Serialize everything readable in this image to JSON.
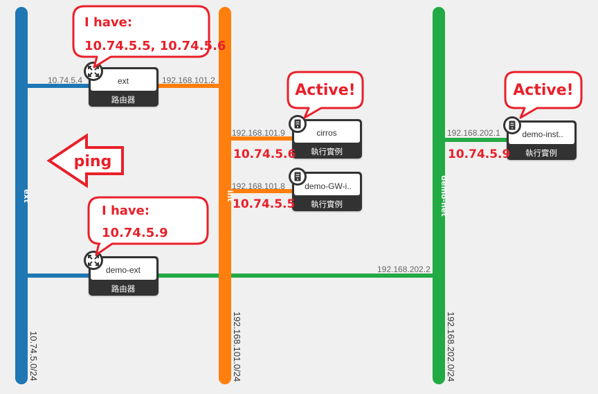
{
  "networks": [
    {
      "id": "ext",
      "label": "ext",
      "cidr": "10.74.5.0/24",
      "color": "#1f77b4"
    },
    {
      "id": "int",
      "label": "int",
      "cidr": "192.168.101.0/24",
      "color": "#ff7f0e"
    },
    {
      "id": "demo-net",
      "label": "demo-net",
      "cidr": "192.168.202.0/24",
      "color": "#22aa44"
    }
  ],
  "routers": [
    {
      "id": "router-ext",
      "name": "ext",
      "type_label": "路由器",
      "icon": "router-icon",
      "ports": [
        {
          "ip": "10.74.5.4"
        },
        {
          "ip": "192.168.101.2"
        }
      ]
    },
    {
      "id": "router-demo-ext",
      "name": "demo-ext",
      "type_label": "路由器",
      "icon": "router-icon",
      "ports": [
        {
          "ip": "192.168.202.2"
        }
      ]
    }
  ],
  "instances": [
    {
      "id": "instance-cirros",
      "name": "cirros",
      "type_label": "執行實例",
      "icon": "server-icon",
      "ip": "192.168.101.9"
    },
    {
      "id": "instance-demo-gw",
      "name": "demo-GW-i..",
      "type_label": "執行實例",
      "icon": "server-icon",
      "ip": "192.168.101.8"
    },
    {
      "id": "instance-demo-inst",
      "name": "demo-inst..",
      "type_label": "執行實例",
      "icon": "server-icon",
      "ip": "192.168.202.1"
    }
  ],
  "annotations": {
    "callout_router_ext": {
      "title": "I have:",
      "value": "10.74.5.5, 10.74.5.6"
    },
    "callout_router_demo_ext": {
      "title": "I have:",
      "value": "10.74.5.9"
    },
    "callout_cirros": "Active!",
    "callout_demo_inst": "Active!",
    "floating_ip_cirros": "10.74.5.6",
    "floating_ip_demo_gw": "10.74.5.5",
    "floating_ip_demo_inst": "10.74.5.9",
    "ping_label": "ping",
    "accent_color": "#e8202a"
  }
}
